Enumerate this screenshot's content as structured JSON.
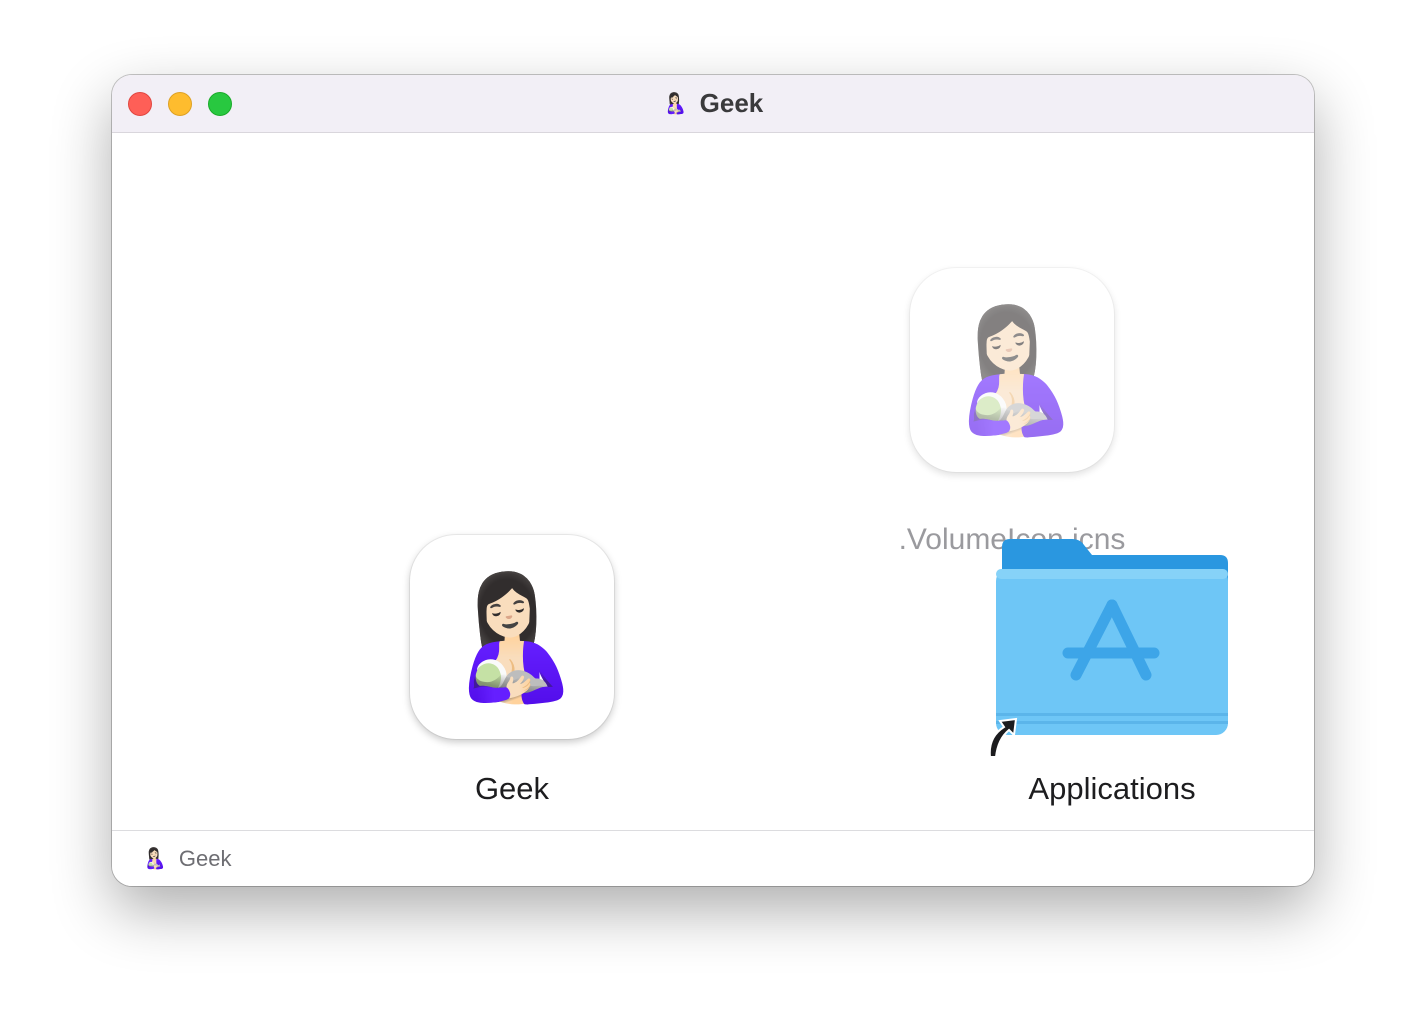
{
  "window": {
    "title": "Geek",
    "title_icon": "breastfeeding-emoji",
    "emoji": "🤱🏻"
  },
  "items": {
    "volume_icon_label": ".VolumeIcon.icns",
    "app_label": "Geek",
    "applications_label": "Applications"
  },
  "statusbar": {
    "path_label": "Geek"
  },
  "colors": {
    "close": "#fe5f57",
    "minimize": "#febc2e",
    "maximize": "#28c840",
    "folder": "#6ec6f6"
  }
}
